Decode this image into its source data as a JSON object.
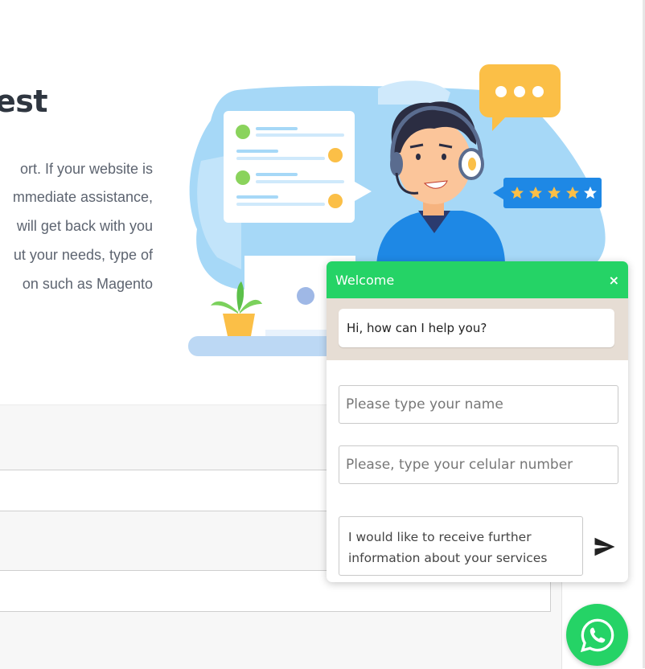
{
  "hero": {
    "heading": "est",
    "paragraph_lines": [
      "ort. If your website is",
      "mmediate assistance,",
      "will get back with you",
      "ut your needs, type of",
      "on such as Magento"
    ]
  },
  "illustration": {
    "rating_stars": 5
  },
  "chat": {
    "title": "Welcome",
    "close_label": "×",
    "greeting": "Hi, how can I help you?",
    "name_placeholder": "Please type your name",
    "phone_placeholder": "Please, type your celular number",
    "message_value": "I would like to receive further information about your services"
  },
  "colors": {
    "whatsapp_green": "#25d366",
    "chat_body_bg": "#e6ddd4",
    "illustration_blue": "#a6d8f7",
    "accent_orange": "#fbbf47",
    "badge_blue": "#1e88e5"
  },
  "icons": {
    "send": "send-icon",
    "whatsapp": "whatsapp-icon"
  }
}
